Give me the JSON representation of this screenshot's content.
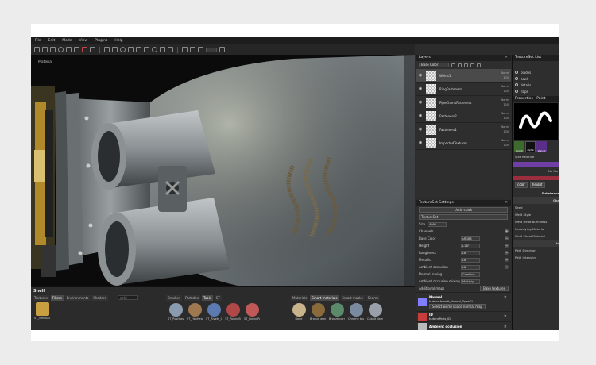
{
  "menu": [
    "File",
    "Edit",
    "Mode",
    "View",
    "Plugins",
    "Help"
  ],
  "viewport": {
    "label": "Material"
  },
  "shelf": {
    "title": "Shelf",
    "tabs_left": [
      "Textures",
      "Filters",
      "Environments",
      "Shaders"
    ],
    "search_value": "wrld",
    "tabs_mid": [
      "Brushes",
      "Particles",
      "Tools",
      "ST"
    ],
    "tabs_right": [
      "Materials",
      "Smart materials",
      "Smart masks",
      "Search"
    ],
    "left_items": [
      {
        "label": "ST_WeldGlo"
      }
    ],
    "mid_items": [
      {
        "label": "ST_PushFast",
        "color": "#8a9bb0"
      },
      {
        "label": "ST_HexHead",
        "color": "#a07850"
      },
      {
        "label": "ST_Rivets_Ca",
        "color": "#5a7ab0"
      },
      {
        "label": "ST_RoundB",
        "color": "#b04848"
      },
      {
        "label": "ST_RoundPa",
        "color": "#c05858"
      }
    ],
    "right_items": [
      {
        "label": "Bone",
        "color": "#c8b48a"
      },
      {
        "label": "Bronze armor",
        "color": "#8a6a3a"
      },
      {
        "label": "Bronze corr...",
        "color": "#5a8a6a"
      },
      {
        "label": "Chrome blu...",
        "color": "#7a8aa0"
      },
      {
        "label": "Cobalt dam...",
        "color": "#9aa0aa"
      }
    ]
  },
  "layers": {
    "title": "Layers",
    "channel": "Base Color",
    "items": [
      {
        "name": "Welds1",
        "blend": "Norm",
        "opacity": "100",
        "active": true
      },
      {
        "name": "RingFasteners",
        "blend": "Norm",
        "opacity": "100",
        "active": false
      },
      {
        "name": "PipeClampFasteners",
        "blend": "Norm",
        "opacity": "100",
        "active": false
      },
      {
        "name": "Fasteners2",
        "blend": "Norm",
        "opacity": "100",
        "active": false
      },
      {
        "name": "Fasteners1",
        "blend": "Norm",
        "opacity": "100",
        "active": false
      },
      {
        "name": "ImportedTextures",
        "blend": "Norm",
        "opacity": "100",
        "active": false
      }
    ]
  },
  "tss": {
    "title": "TextureSet Settings",
    "undo_stack": "Undo stack",
    "textureset": "TextureSet",
    "size_label": "Size",
    "size_value": "4096",
    "channels": "Channels",
    "params": [
      {
        "label": "Base Color",
        "value": "sRGB8"
      },
      {
        "label": "Height",
        "value": "L16F"
      },
      {
        "label": "Roughness",
        "value": "L8"
      },
      {
        "label": "Metallic",
        "value": "L8"
      },
      {
        "label": "Ambient occlusion",
        "value": "L8"
      }
    ],
    "normal_mixing_label": "Normal mixing",
    "normal_mixing_value": "Combine",
    "ao_mixing_label": "Ambient occlusion mixing",
    "ao_mixing_value": "Multiply",
    "additional_maps": "Additional maps",
    "bake_button": "Bake textures",
    "maps": [
      {
        "title": "Normal",
        "sub": "turbine.fnomtt_Normal_OpenGL",
        "button": "Select world space normal map",
        "color": "#7f7fff"
      },
      {
        "title": "ID",
        "sub": "turbineParts_ID",
        "button": "",
        "color": "#c83c3c"
      },
      {
        "title": "Ambient occlusion",
        "sub": "",
        "button": "",
        "color": "#bbbbbb"
      }
    ]
  },
  "textureset_list": {
    "title": "TextureSet List",
    "items": [
      "blades",
      "cowl",
      "details",
      "flaps"
    ]
  },
  "properties": {
    "title": "Properties - Paint",
    "minis": [
      {
        "label": "brush",
        "color": "#3d6b2e"
      },
      {
        "label": "alpha",
        "color": "#111111"
      },
      {
        "label": "stencil",
        "color": "#5a2f8a"
      }
    ],
    "size_row": "Size Relative",
    "no_material": "No Ma",
    "btn_color": "color",
    "btn_height": "height",
    "substance": "Substance",
    "channel_head": "Cha",
    "seed": "Seed",
    "lines": [
      "Weld Style",
      "Weld Head Burniness",
      "Underlying Material",
      "Weld Metal Material"
    ],
    "bottom_head": "In",
    "bottom_lines": [
      "Path Direction",
      "Path Intensity"
    ]
  }
}
